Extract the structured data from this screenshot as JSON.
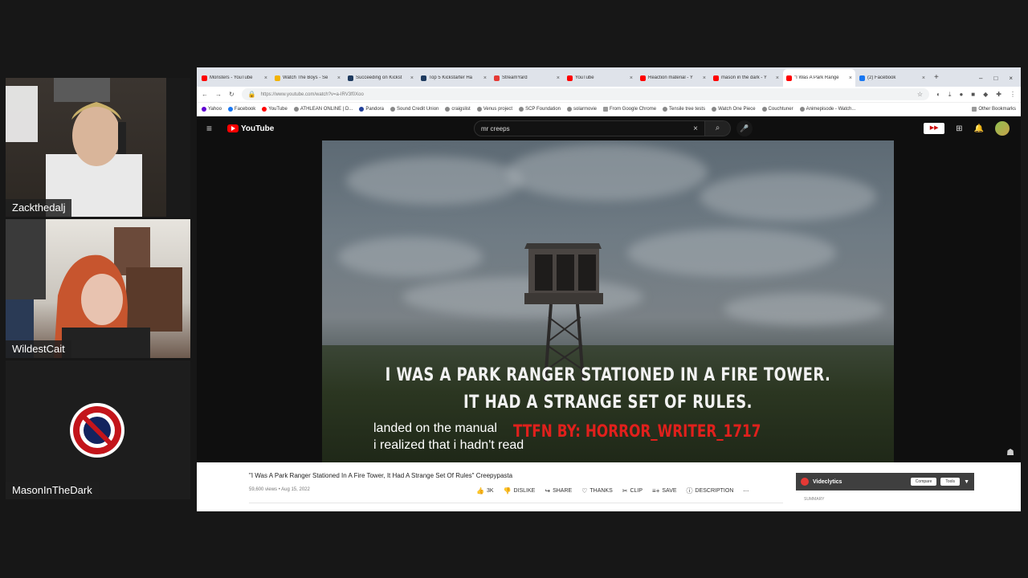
{
  "participants": [
    {
      "name": "Zackthedalj"
    },
    {
      "name": "WildestCait"
    },
    {
      "name": "MasonInTheDark"
    }
  ],
  "browser": {
    "tabs": [
      {
        "title": "Monsters - YouTube",
        "icon_color": "#ff0000",
        "close": "×"
      },
      {
        "title": "Watch The Boys - Se",
        "icon_color": "#f2b300",
        "close": "×"
      },
      {
        "title": "Succeeding on Kickst",
        "icon_color": "#1e3a5f",
        "close": "×"
      },
      {
        "title": "Top 5 Kickstarter Ha",
        "icon_color": "#1e3a5f",
        "close": "×"
      },
      {
        "title": "StreamYard",
        "icon_color": "#e53935",
        "close": "×"
      },
      {
        "title": "YouTube",
        "icon_color": "#ff0000",
        "close": "×"
      },
      {
        "title": "Reaction material - Y",
        "icon_color": "#ff0000",
        "close": "×"
      },
      {
        "title": "mason in the dark - Y",
        "icon_color": "#ff0000",
        "close": "×"
      },
      {
        "title": "\"I Was A Park Range",
        "icon_color": "#ff0000",
        "close": "×"
      },
      {
        "title": "(2) Facebook",
        "icon_color": "#1877f2",
        "close": "×"
      }
    ],
    "new_tab": "+",
    "window_controls": [
      "–",
      "□",
      "×"
    ],
    "url": "https://www.youtube.com/watch?v=a-IRV3f0Xoo",
    "bookmarks": [
      "Yahoo",
      "Facebook",
      "YouTube",
      "ATHLEAN ONLINE | D...",
      "Pandora",
      "Sound Credit Union",
      "craigslist",
      "Venus project",
      "SCP Foundation",
      "solarmovie",
      "From Google Chrome",
      "Tensile tree tests",
      "Watch One Piece",
      "Couchtuner",
      "Animepisode - Watch..."
    ],
    "other_bookmarks": "Other Bookmarks"
  },
  "youtube": {
    "logo": "YouTube",
    "search_value": "mr creeps",
    "clear_glyph": "×",
    "search_glyph": "⌕",
    "mic_glyph": "🎤",
    "video": {
      "caption_line1": "I WAS A PARK RANGER STATIONED IN A FIRE TOWER.",
      "caption_line2": "IT HAD A STRANGE SET OF RULES.",
      "subtitle_line1": "landed on the manual",
      "subtitle_line2": "i realized that i hadn't read",
      "credit": "TTFN BY: HORROR_WRITER_1717"
    },
    "title": "\"I Was A Park Ranger Stationed In A Fire Tower, It Had A Strange Set Of Rules\" Creepypasta",
    "meta": "59,600 views • Aug 15, 2022",
    "actions": {
      "like": "3K",
      "dislike": "DISLIKE",
      "share": "SHARE",
      "thanks": "THANKS",
      "clip": "CLIP",
      "save": "SAVE",
      "description": "DESCRIPTION",
      "more": "⋯"
    },
    "vidiq": {
      "name": "Videclytics",
      "compare": "Compare",
      "tools": "Tools",
      "summary": "SUMMARY"
    }
  }
}
